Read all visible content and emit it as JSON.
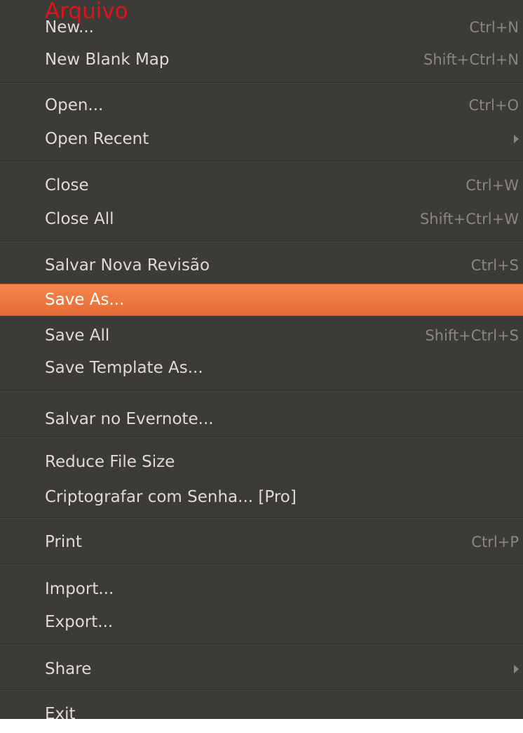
{
  "menu_title": "Arquivo",
  "items": [
    {
      "label": "New...",
      "shortcut": "Ctrl+N"
    },
    {
      "label": "New Blank Map",
      "shortcut": "Shift+Ctrl+N"
    },
    {
      "label": "Open...",
      "shortcut": "Ctrl+O"
    },
    {
      "label": "Open Recent",
      "shortcut": ""
    },
    {
      "label": "Close",
      "shortcut": "Ctrl+W"
    },
    {
      "label": "Close All",
      "shortcut": "Shift+Ctrl+W"
    },
    {
      "label": "Salvar Nova Revisão",
      "shortcut": "Ctrl+S"
    },
    {
      "label": "Save As...",
      "shortcut": ""
    },
    {
      "label": "Save All",
      "shortcut": "Shift+Ctrl+S"
    },
    {
      "label": "Save Template As...",
      "shortcut": ""
    },
    {
      "label": "Salvar no Evernote...",
      "shortcut": ""
    },
    {
      "label": "Reduce File Size",
      "shortcut": ""
    },
    {
      "label": "Criptografar com Senha... [Pro]",
      "shortcut": ""
    },
    {
      "label": "Print",
      "shortcut": "Ctrl+P"
    },
    {
      "label": "Import...",
      "shortcut": ""
    },
    {
      "label": "Export...",
      "shortcut": ""
    },
    {
      "label": "Share",
      "shortcut": ""
    },
    {
      "label": "Exit",
      "shortcut": ""
    }
  ],
  "highlighted_item": "Save As...",
  "colors": {
    "menu_background": "#3c3b37",
    "highlight": "#f07746",
    "title_overlay": "#e0121b"
  }
}
